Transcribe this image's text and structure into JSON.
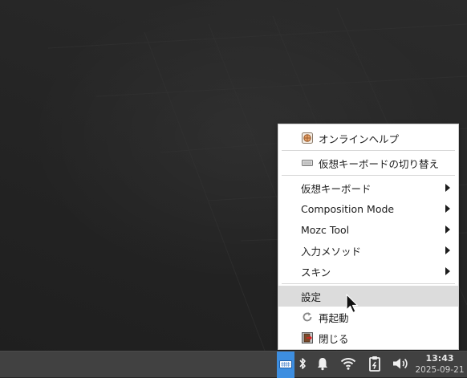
{
  "menu": {
    "items": [
      {
        "label": "オンラインヘルプ",
        "icon": "globe-help-icon",
        "submenu": false
      },
      {
        "label": "仮想キーボードの切り替え",
        "icon": "keyboard-icon",
        "submenu": false
      },
      {
        "label": "仮想キーボード",
        "submenu": true
      },
      {
        "label": "Composition Mode",
        "submenu": true
      },
      {
        "label": "Mozc Tool",
        "submenu": true
      },
      {
        "label": "入力メソッド",
        "submenu": true
      },
      {
        "label": "スキン",
        "submenu": true
      },
      {
        "label": "設定",
        "submenu": false,
        "highlighted": true
      },
      {
        "label": "再起動",
        "icon": "restart-icon",
        "submenu": false
      },
      {
        "label": "閉じる",
        "icon": "close-door-icon",
        "submenu": false
      }
    ]
  },
  "taskbar": {
    "tray_icons": [
      "keyboard-icon",
      "bluetooth-icon",
      "bell-icon",
      "wifi-icon",
      "clipboard-icon",
      "volume-icon"
    ],
    "clock": {
      "time": "13:43",
      "date": "2025-09-21"
    }
  },
  "colors": {
    "desktop": "#262626",
    "menu_bg": "#ffffff",
    "menu_highlight": "#dcdcdc",
    "taskbar": "#414141",
    "tray_active": "#3d8ee0"
  }
}
